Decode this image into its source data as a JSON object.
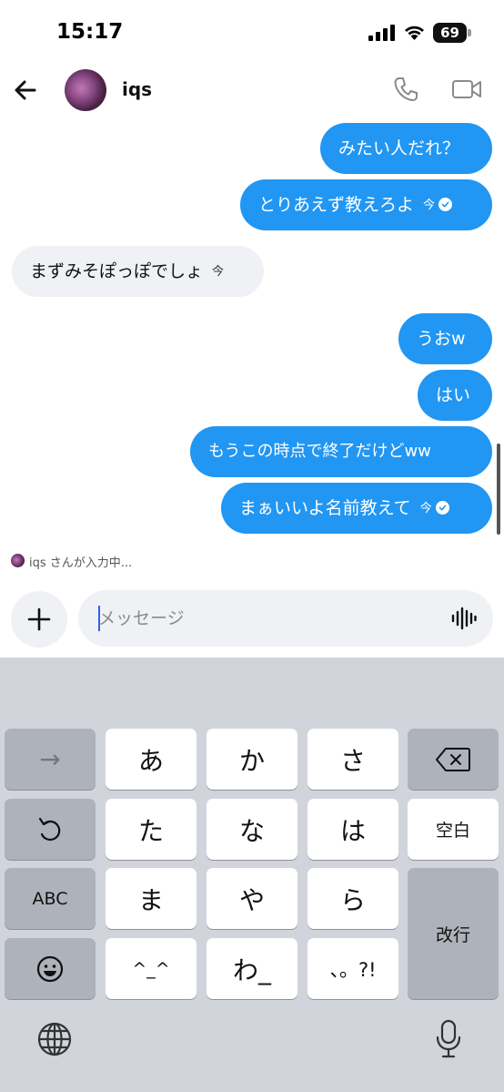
{
  "status_bar": {
    "time": "15:17",
    "battery": "69"
  },
  "header": {
    "contact_name": "iqs"
  },
  "messages": [
    {
      "text": "みたい人だれ？",
      "direction": "out"
    },
    {
      "text": "とりあえず教えろよ",
      "direction": "out",
      "time": "今",
      "seen": true
    },
    {
      "text": "まずみそぽっぽでしょ",
      "direction": "in",
      "time": "今"
    },
    {
      "text": "うおw",
      "direction": "out"
    },
    {
      "text": "はい",
      "direction": "out"
    },
    {
      "text": "もうこの時点で終了だけどww",
      "direction": "out"
    },
    {
      "text": "まぁいいよ名前教えて",
      "direction": "out",
      "time": "今",
      "seen": true
    }
  ],
  "typing_indicator": "iqs さんが入力中...",
  "composer": {
    "placeholder": "メッセージ"
  },
  "keyboard": {
    "keys": {
      "next": "→",
      "a": "あ",
      "ka": "か",
      "sa": "さ",
      "undo": "↺",
      "ta": "た",
      "na": "な",
      "ha": "は",
      "space": "空白",
      "abc": "ABC",
      "ma": "ま",
      "ya": "や",
      "ra": "ら",
      "return": "改行",
      "emoji": "☺",
      "kaomoji": "^_^",
      "wa": "わ_",
      "punct": "、。?!"
    }
  },
  "colors": {
    "outgoing_bubble": "#2196f3",
    "incoming_bubble": "#eff1f4",
    "caret": "#2b63e6"
  },
  "icons": [
    "back-arrow-icon",
    "phone-icon",
    "video-camera-icon",
    "seen-check-icon",
    "plus-icon",
    "voice-waveform-icon",
    "backspace-icon",
    "undo-icon",
    "emoji-icon",
    "globe-icon",
    "microphone-icon"
  ]
}
